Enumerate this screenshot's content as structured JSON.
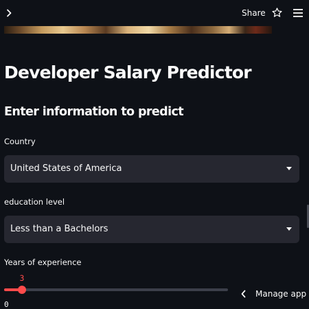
{
  "toolbar": {
    "expand_icon": "chevron-right-icon",
    "share_label": "Share",
    "star_icon": "star-icon",
    "menu_icon": "hamburger-menu-icon"
  },
  "main": {
    "title": "Developer Salary Predictor",
    "subtitle": "Enter information to predict"
  },
  "form": {
    "country": {
      "label": "Country",
      "value": "United States of America"
    },
    "education": {
      "label": "education level",
      "value": "Less than a Bachelors"
    },
    "experience": {
      "label": "Years of experience",
      "value": "3",
      "min": "0",
      "fraction": 0.08
    }
  },
  "footer": {
    "manage_label": "Manage app"
  },
  "colors": {
    "background": "#0e1117",
    "widget": "#262730",
    "accent": "#ff4b4b",
    "text": "#fafafa"
  }
}
